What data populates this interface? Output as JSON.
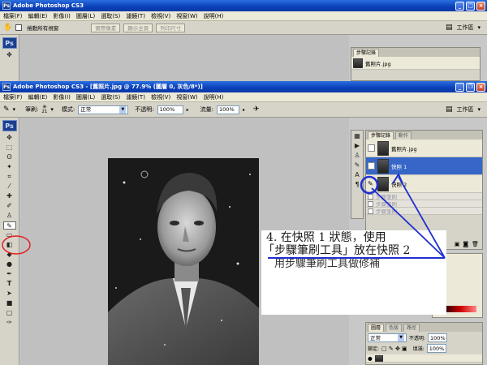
{
  "back_window": {
    "title": "Adobe Photoshop CS3",
    "menu": [
      "檔案(F)",
      "編輯(E)",
      "影像(I)",
      "圖層(L)",
      "選取(S)",
      "濾鏡(T)",
      "檢視(V)",
      "視窗(W)",
      "說明(H)"
    ],
    "options": {
      "scroll_all_label": "捲動所有視窗",
      "actual_pixels": "實際像素",
      "fit_screen": "顯示全頁",
      "print_size": "列印尺寸"
    },
    "workspace_label": "工作區",
    "history_tab": "步驟記錄",
    "history_item": "舊照片.jpg"
  },
  "front_window": {
    "title": "Adobe Photoshop CS3 - [舊照片.jpg @ 77.9% (圖層 0, 灰色/8*)]",
    "menu": [
      "檔案(F)",
      "編輯(E)",
      "影像(I)",
      "圖層(L)",
      "選取(S)",
      "濾鏡(T)",
      "檢視(V)",
      "視窗(W)",
      "說明(H)"
    ],
    "options": {
      "brush_label": "筆刷:",
      "brush_size": "21",
      "mode_label": "模式:",
      "mode_value": "正常",
      "opacity_label": "不透明:",
      "opacity_value": "100%",
      "flow_label": "流量:",
      "flow_value": "100%"
    },
    "workspace_label": "工作區"
  },
  "history_panel": {
    "tabs": [
      "步驟記錄",
      "動作"
    ],
    "source": "舊照片.jpg",
    "items": [
      "快照 1",
      "快照 2"
    ],
    "faded_items": [
      "步驟筆刷",
      "步驟筆刷",
      "步驟筆刷"
    ]
  },
  "layers_panel": {
    "tabs": [
      "圖層",
      "色版",
      "路徑"
    ],
    "blend_mode": "正常",
    "opacity_label": "不透明:",
    "opacity_value": "100%",
    "lock_label": "鎖定:",
    "fill_label": "填滿:",
    "fill_value": "100%"
  },
  "callout": {
    "line1": "4. 在快照 1 狀態，使用",
    "line2": "「步驟筆刷工具」放在快照 2",
    "line3": "用步驟筆刷工具做修補"
  },
  "colors": {
    "title_blue": "#0a3fb8",
    "selection": "#3666c8",
    "annotation_blue": "#1f2fd0",
    "annotation_red": "#e02020"
  }
}
